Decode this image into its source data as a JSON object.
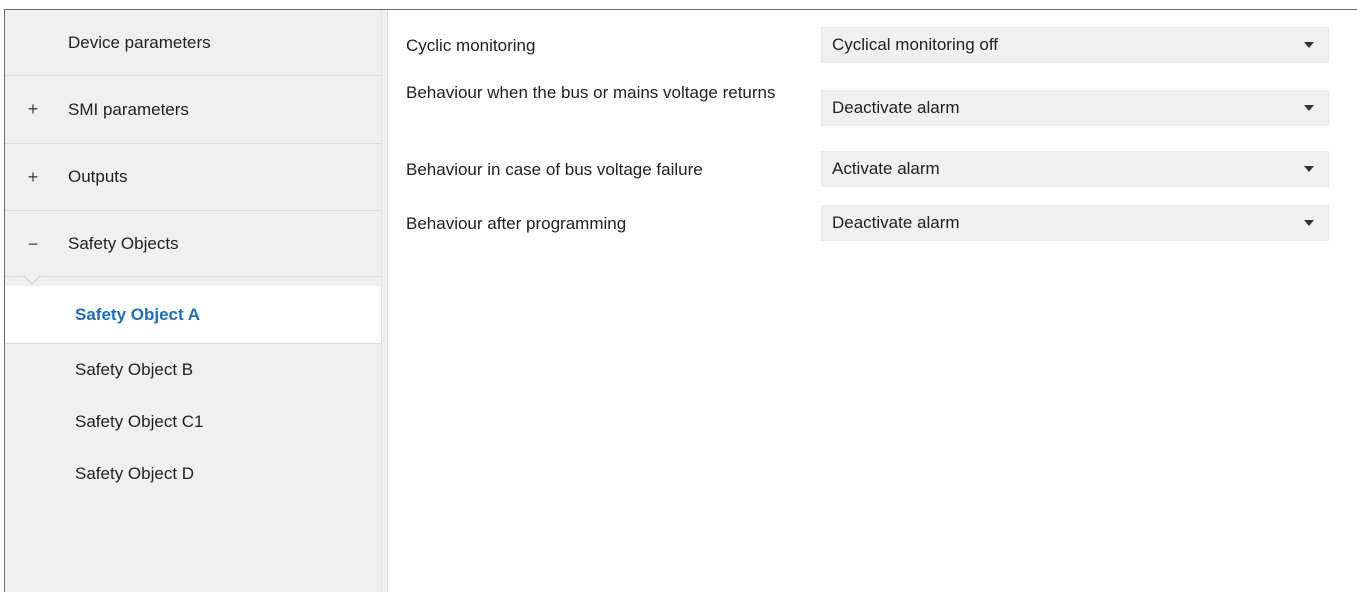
{
  "sidebar": {
    "items": [
      {
        "expander": "",
        "label": "Device parameters"
      },
      {
        "expander": "+",
        "label": "SMI parameters"
      },
      {
        "expander": "+",
        "label": "Outputs"
      },
      {
        "expander": "−",
        "label": "Safety Objects"
      }
    ],
    "children": [
      {
        "label": "Safety Object A",
        "selected": true
      },
      {
        "label": "Safety Object B"
      },
      {
        "label": "Safety Object C1"
      },
      {
        "label": "Safety Object D"
      }
    ]
  },
  "parameters": [
    {
      "label": "Cyclic monitoring",
      "value": "Cyclical monitoring off"
    },
    {
      "label": "Behaviour when the bus or mains voltage returns",
      "value": "Deactivate alarm"
    },
    {
      "label": "Behaviour in case of bus voltage failure",
      "value": "Activate alarm"
    },
    {
      "label": "Behaviour after programming",
      "value": "Deactivate alarm"
    }
  ],
  "colors": {
    "selected_text": "#1e6fb8",
    "sidebar_bg": "#f0f0f0",
    "dropdown_bg": "#f0f0f0"
  }
}
